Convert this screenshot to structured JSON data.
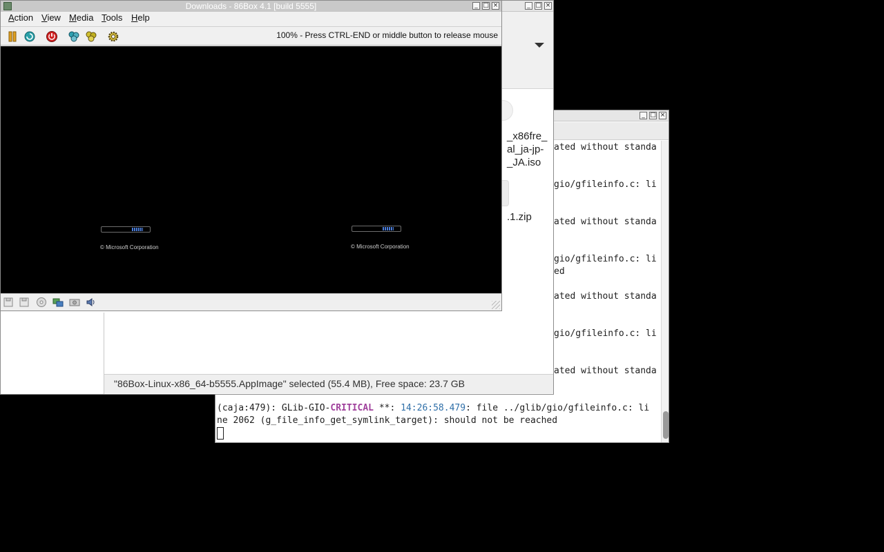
{
  "box86": {
    "title": "Downloads - 86Box 4.1 [build 5555]",
    "menus": [
      {
        "u": "A",
        "rest": "ction"
      },
      {
        "u": "V",
        "rest": "iew"
      },
      {
        "u": "M",
        "rest": "edia"
      },
      {
        "u": "T",
        "rest": "ools"
      },
      {
        "u": "H",
        "rest": "elp"
      }
    ],
    "toolbar_icons": [
      "pause-icon",
      "reset-icon",
      "power-icon",
      "ctrl-alt-del-icon",
      "ctrl-alt-esc-icon",
      "settings-icon"
    ],
    "status_message": "100% - Press CTRL-END or middle button to release mouse",
    "screen": {
      "copyright_left": "© Microsoft Corporation",
      "copyright_right": "© Microsoft Corporation"
    },
    "status_icons": [
      "floppy-a-icon",
      "floppy-b-icon",
      "cdrom-icon",
      "network-icon",
      "hard-disk-icon",
      "sound-icon"
    ]
  },
  "filemanager": {
    "file_labels": [
      "_x86fre_",
      "al_ja-jp-",
      "_JA.iso",
      ".1.zip"
    ],
    "status": "\"86Box-Linux-x86_64-b5555.AppImage\" selected (55.4 MB), Free space: 23.7 GB"
  },
  "terminal": {
    "lines": [
      "ated without standa",
      "gio/gfileinfo.c: li",
      "ated without standa",
      "gio/gfileinfo.c: li",
      "ed",
      "ated without standa",
      "gio/gfileinfo.c: li",
      "ated without standa"
    ],
    "critical_line": {
      "prefix": "(caja:479): GLib-GIO-",
      "level": "CRITICAL",
      "sep": " **: ",
      "time": "14:26:58.479",
      "rest": ": file ../glib/gio/gfileinfo.c: li"
    },
    "last_line": "ne 2062 (g_file_info_get_symlink_target): should not be reached"
  },
  "colors": {
    "desktop": "#000000",
    "critical": "#a0419c",
    "timestamp": "#2f6fa8"
  }
}
